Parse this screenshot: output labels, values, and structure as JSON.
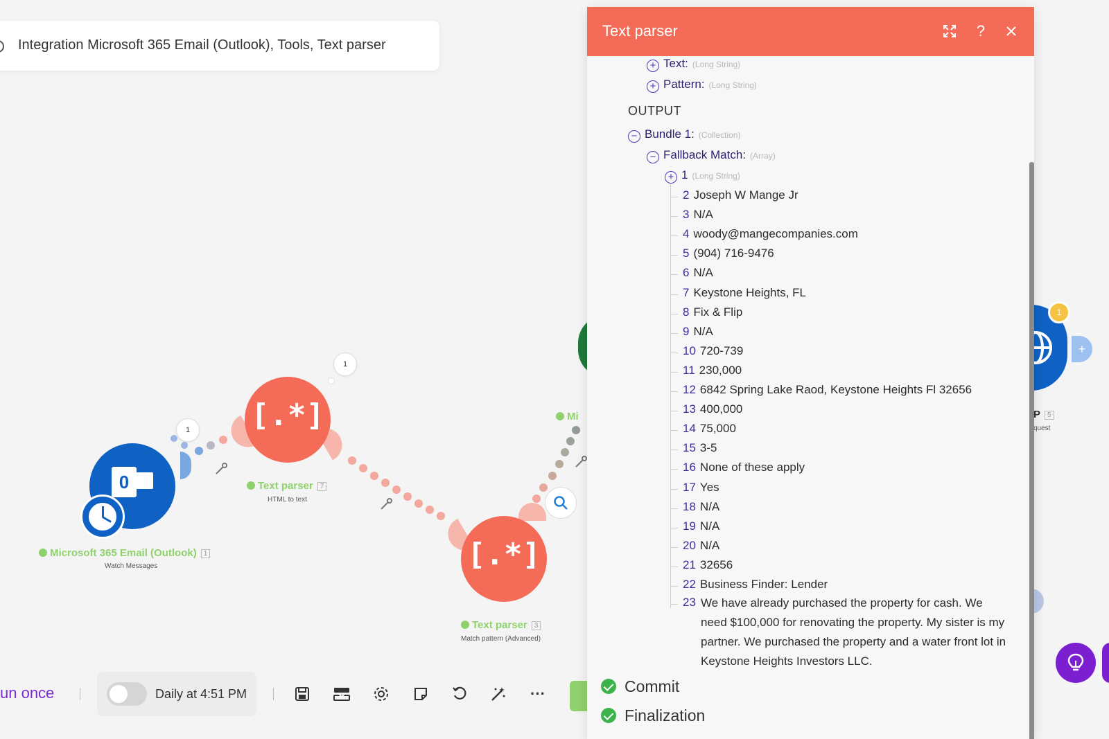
{
  "scenario": {
    "breadcrumb": "Integration Microsoft 365 Email (Outlook), Tools, Text parser"
  },
  "modules": [
    {
      "name": "Microsoft 365 Email (Outlook)",
      "badge": "1",
      "subtitle": "Watch Messages",
      "bubble": "1"
    },
    {
      "name": "Text parser",
      "badge": "7",
      "subtitle": "HTML to text",
      "bubble": "1"
    },
    {
      "name": "Text parser",
      "badge": "3",
      "subtitle": "Match pattern (Advanced)"
    },
    {
      "name": "Mi"
    },
    {
      "name": "P",
      "badge": "5",
      "subtitle": "quest",
      "bubble": "1"
    }
  ],
  "toolbar": {
    "run_once": "un once",
    "schedule": "Daily at 4:51 PM",
    "tools": [
      "save-icon",
      "explain-flow-icon",
      "settings-icon",
      "notes-icon",
      "undo-icon",
      "auto-align-icon",
      "more-icon"
    ]
  },
  "panel": {
    "title": "Text parser",
    "header_icons": [
      "expand-icon",
      "help-icon",
      "close-icon"
    ],
    "input_fields": [
      {
        "label": "Text:",
        "type": "(Long String)"
      },
      {
        "label": "Pattern:",
        "type": "(Long String)"
      }
    ],
    "output_label": "OUTPUT",
    "bundle": {
      "label": "Bundle 1:",
      "type": "(Collection)"
    },
    "fallback": {
      "label": "Fallback Match:",
      "type": "(Array)"
    },
    "first_item": {
      "index": "1",
      "type": "(Long String)"
    },
    "items": [
      {
        "index": "2",
        "value": "Joseph W Mange Jr"
      },
      {
        "index": "3",
        "value": "N/A"
      },
      {
        "index": "4",
        "value": "woody@mangecompanies.com"
      },
      {
        "index": "5",
        "value": "(904) 716-9476"
      },
      {
        "index": "6",
        "value": "N/A"
      },
      {
        "index": "7",
        "value": "Keystone Heights, FL"
      },
      {
        "index": "8",
        "value": "Fix & Flip"
      },
      {
        "index": "9",
        "value": "N/A"
      },
      {
        "index": "10",
        "value": "720-739"
      },
      {
        "index": "11",
        "value": "230,000"
      },
      {
        "index": "12",
        "value": "6842 Spring Lake Raod, Keystone Heights Fl 32656"
      },
      {
        "index": "13",
        "value": "400,000"
      },
      {
        "index": "14",
        "value": "75,000"
      },
      {
        "index": "15",
        "value": "3-5"
      },
      {
        "index": "16",
        "value": "None of these apply"
      },
      {
        "index": "17",
        "value": "Yes"
      },
      {
        "index": "18",
        "value": "N/A"
      },
      {
        "index": "19",
        "value": "N/A"
      },
      {
        "index": "20",
        "value": "N/A"
      },
      {
        "index": "21",
        "value": "32656"
      },
      {
        "index": "22",
        "value": "Business Finder: Lender"
      }
    ],
    "last_item": {
      "index": "23",
      "lines": [
        "We have already purchased the property for cash. We",
        "need $100,000 for renovating the property. My sister is my",
        "partner. We purchased the property and a water front lot in",
        "Keystone Heights Investors LLC."
      ]
    },
    "statuses": [
      "Commit",
      "Finalization"
    ]
  },
  "colors": {
    "panel_header": "#f46b57",
    "module_red": "#f46b57",
    "outlook_blue": "#0f62c4",
    "success_green": "#8fd16c",
    "accent_purple": "#7b2bd1"
  }
}
